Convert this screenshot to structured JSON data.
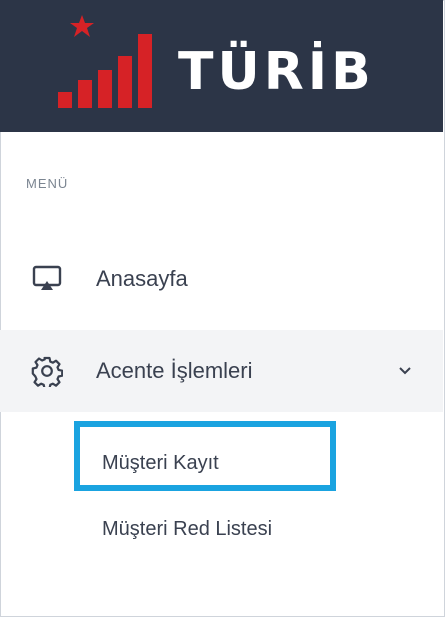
{
  "brand": {
    "name": "TÜRİB"
  },
  "menu": {
    "caption": "MENÜ",
    "items": [
      {
        "label": "Anasayfa",
        "icon": "monitor-icon"
      },
      {
        "label": "Acente İşlemleri",
        "icon": "gear-icon",
        "expanded": true,
        "children": [
          {
            "label": "Müşteri Kayıt",
            "highlighted": true
          },
          {
            "label": "Müşteri Red Listesi"
          }
        ]
      }
    ]
  },
  "colors": {
    "header_bg": "#2c3547",
    "logo_red": "#d62226",
    "highlight_border": "#1aa3e0",
    "active_row_bg": "#f3f4f6"
  }
}
